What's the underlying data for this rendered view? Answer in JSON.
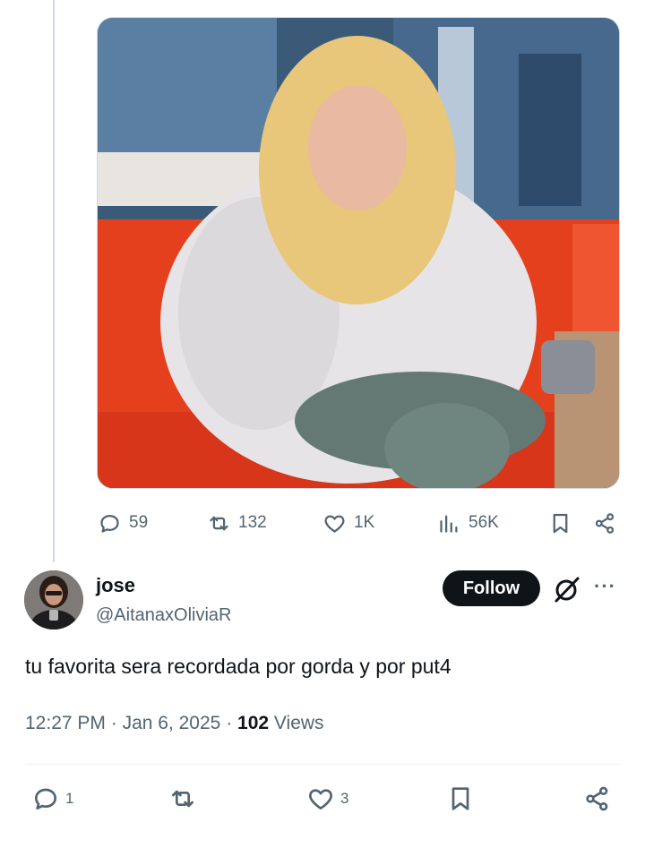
{
  "parent_tweet": {
    "actions": {
      "reply_count": "59",
      "repost_count": "132",
      "like_count": "1K",
      "views_count": "56K"
    }
  },
  "reply": {
    "author_name": "jose",
    "author_handle": "@AitanaxOliviaR",
    "follow_label": "Follow",
    "more_label": "···",
    "text": "tu favorita sera recordada por gorda y por put4",
    "time": "12:27 PM",
    "separator": "·",
    "date": "Jan 6, 2025",
    "views_number": "102",
    "views_label": "Views",
    "actions": {
      "reply_count": "1",
      "like_count": "3"
    }
  },
  "colors": {
    "secondary_text": "#536471",
    "primary_text": "#0f1419",
    "follow_bg": "#0f1419",
    "sofa": "#e4401e",
    "thread_line": "#cfd9de"
  },
  "icons": [
    "reply-icon",
    "repost-icon",
    "like-icon",
    "views-icon",
    "bookmark-icon",
    "share-icon",
    "grok-icon",
    "more-icon"
  ]
}
